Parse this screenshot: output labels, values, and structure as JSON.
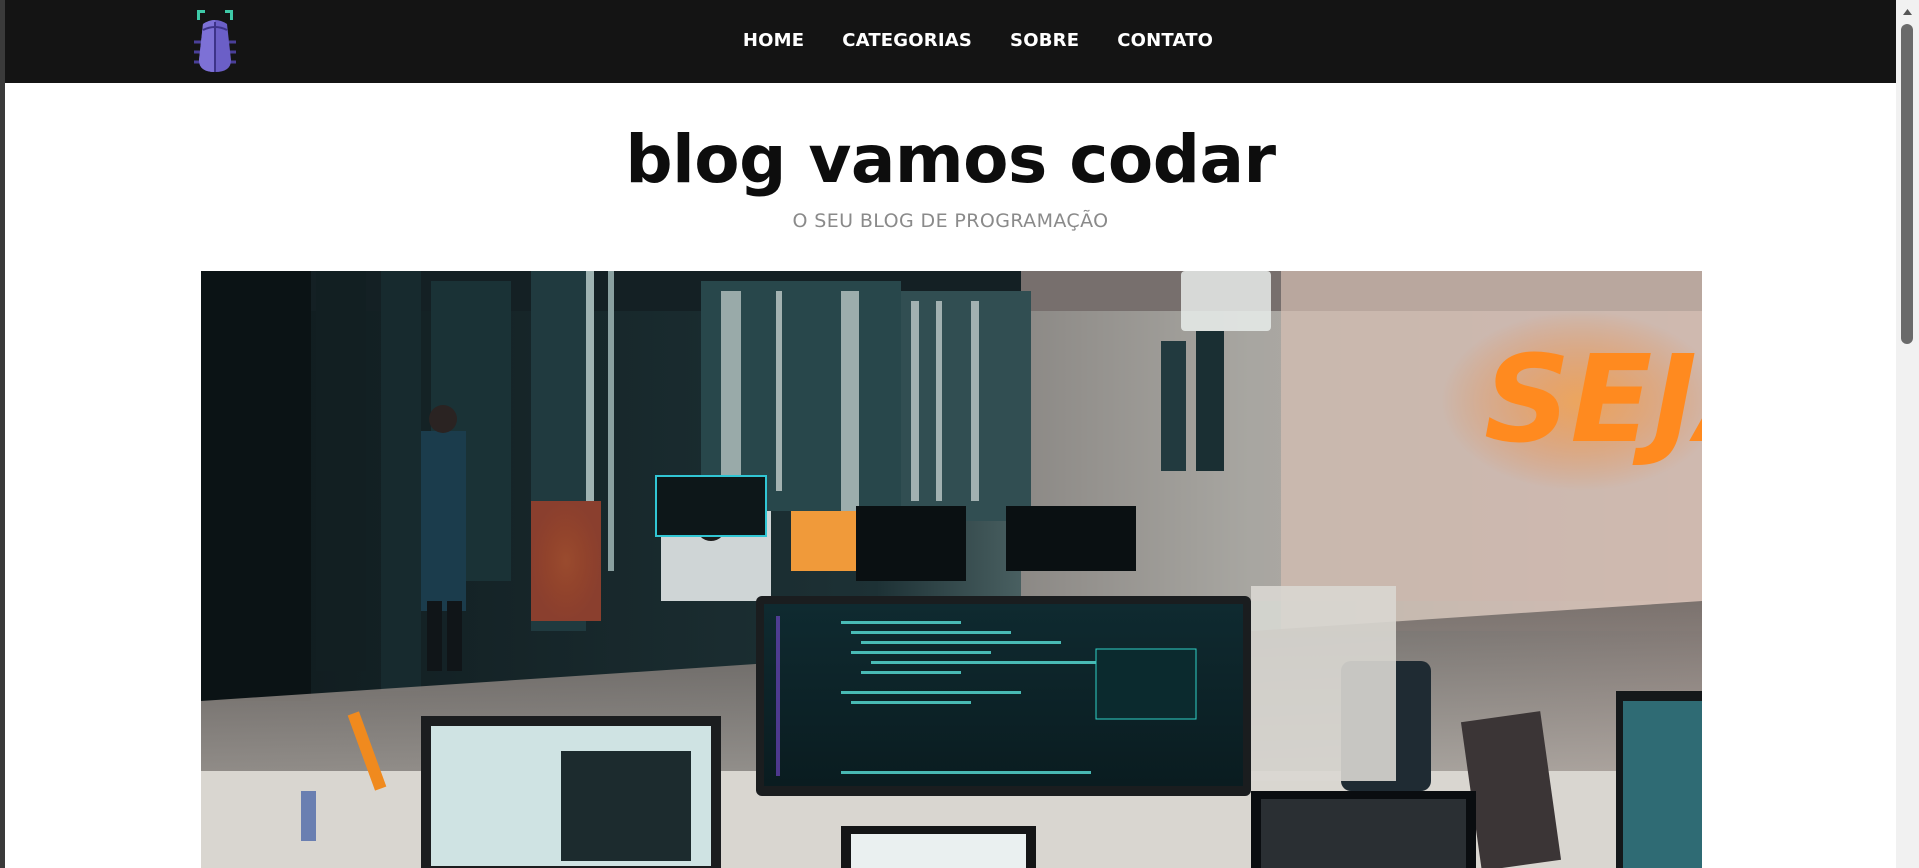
{
  "nav": {
    "logo_icon": "bug-icon",
    "items": [
      {
        "label": "HOME"
      },
      {
        "label": "CATEGORIAS"
      },
      {
        "label": "SOBRE"
      },
      {
        "label": "CONTATO"
      }
    ]
  },
  "header": {
    "title": "blog vamos codar",
    "subtitle": "O SEU BLOG DE PROGRAMAÇÃO"
  },
  "hero": {
    "image": "office-coding-photo",
    "neon_sign": "SEJA"
  },
  "colors": {
    "navbar": "#141414",
    "logo_purple": "#6b5fc7",
    "logo_antenna": "#3ec9a7",
    "subtitle_gray": "#8a8a8a",
    "neon_orange": "#ff8a1f"
  }
}
